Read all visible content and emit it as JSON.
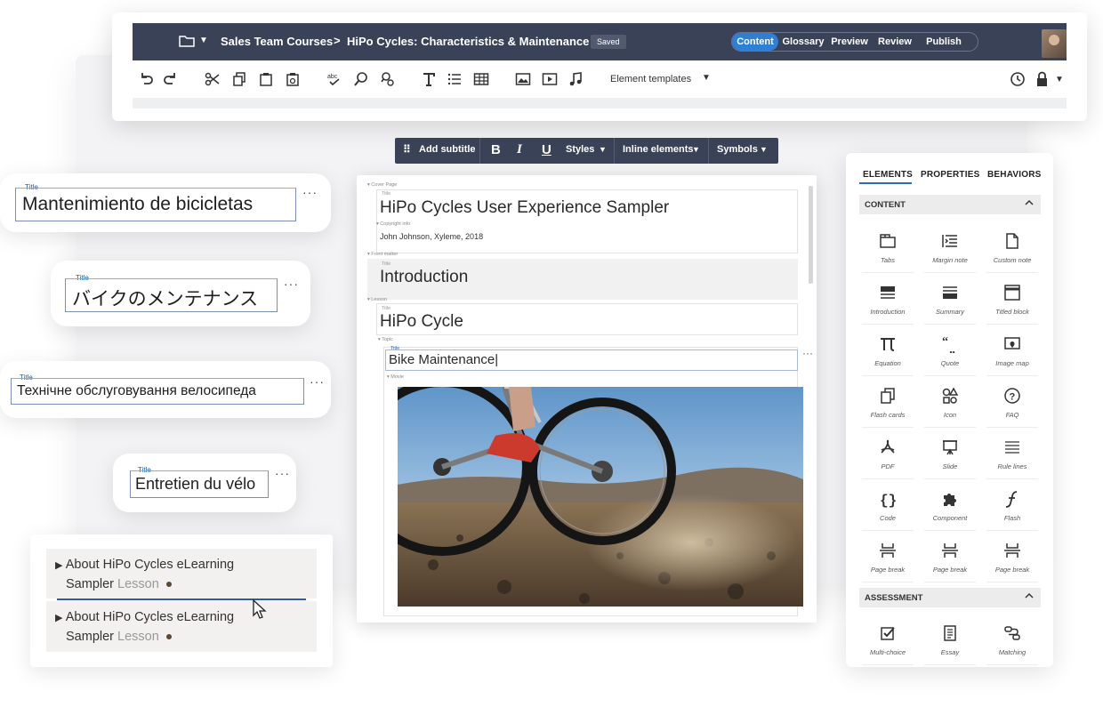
{
  "topbar": {
    "breadcrumb_root": "Sales Team Courses",
    "breadcrumb_separator": ">",
    "breadcrumb_current": "HiPo Cycles: Characteristics & Maintenance",
    "save_status": "Saved",
    "modes": [
      "Content",
      "Glossary",
      "Preview",
      "Review",
      "Publish"
    ],
    "active_mode": "Content"
  },
  "toolbar": {
    "element_templates_label": "Element templates",
    "icons": [
      "undo-icon",
      "redo-icon",
      "cut-icon",
      "copy-icon",
      "paste-icon",
      "paste-special-icon",
      "spellcheck-icon",
      "find-icon",
      "find-replace-icon",
      "text-icon",
      "list-icon",
      "table-icon",
      "image-icon",
      "video-icon",
      "audio-icon",
      "history-icon",
      "lock-icon"
    ]
  },
  "format_bar": {
    "add_subtitle": "Add subtitle",
    "bold": "B",
    "italic": "I",
    "underline": "U",
    "styles": "Styles",
    "inline_elements": "Inline elements",
    "symbols": "Symbols"
  },
  "document": {
    "cover_page_label": "Cover Page",
    "title_label": "Title",
    "cover_title": "HiPo Cycles User Experience Sampler",
    "copyright_label": "Copyright info",
    "copyright_text": "John Johnson, Xyleme, 2018",
    "front_matter_label": "Front matter",
    "intro_title": "Introduction",
    "lesson_label": "Lesson",
    "lesson_title": "HiPo Cycle",
    "topic_label": "Topic",
    "topic_title": "Bike Maintenance|",
    "movie_label": "Movie",
    "more": "···"
  },
  "translations": [
    {
      "label": "Title",
      "text": "Mantenimiento de bicicletas",
      "more": "···"
    },
    {
      "label": "Title",
      "text": "バイクのメンテナンス",
      "more": "···"
    },
    {
      "label": "Title",
      "text": "Технічне обслуговування велосипеда",
      "more": "···"
    },
    {
      "label": "Title",
      "text": "Entretien du vélo",
      "more": "···"
    }
  ],
  "tree": [
    {
      "line1": "About HiPo Cycles eLearning",
      "line2": "Sampler",
      "type": "Lesson"
    },
    {
      "line1": "About HiPo Cycles eLearning",
      "line2": "Sampler",
      "type": "Lesson"
    }
  ],
  "panel": {
    "tabs": [
      "ELEMENTS",
      "PROPERTIES",
      "BEHAVIORS"
    ],
    "active_tab": "ELEMENTS",
    "content_section": "CONTENT",
    "assessment_section": "ASSESSMENT",
    "content_items": [
      "Tabs",
      "Margin note",
      "Custom note",
      "Introduction",
      "Summary",
      "Titled block",
      "Equation",
      "Quote",
      "Image map",
      "Flash cards",
      "Icon",
      "FAQ",
      "PDF",
      "Slide",
      "Rule lines",
      "Code",
      "Component",
      "Flash",
      "Page break",
      "Page break",
      "Page break"
    ],
    "assessment_items": [
      "Multi-choice",
      "Essay",
      "Matching"
    ]
  },
  "colors": {
    "topbar": "#3a4258",
    "accent": "#2e7fd6",
    "tab_underline": "#2a6bbf"
  }
}
